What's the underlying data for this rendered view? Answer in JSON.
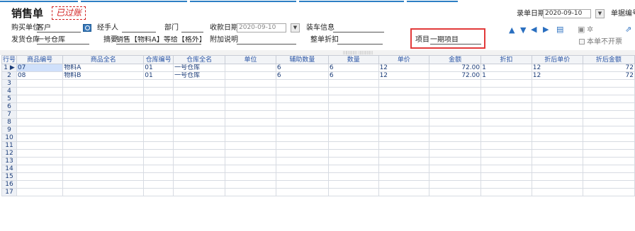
{
  "header": {
    "title": "销售单",
    "stamp": "已过账",
    "record_date_label": "录单日期",
    "record_date_value": "2020-09-10",
    "doc_no_label": "单据编号",
    "not_invoiced_label": "本单不开票"
  },
  "form": {
    "buyer_label": "购买单位",
    "buyer_value": "客户",
    "handler_label": "经手人",
    "handler_value": "",
    "dept_label": "部门",
    "dept_value": "",
    "collect_date_label": "收款日期",
    "collect_date_placeholder": "2020-09-10",
    "loading_label": "装车信息",
    "loading_value": "",
    "warehouse_label": "发货仓库",
    "warehouse_value": "一号仓库",
    "summary_label": "摘要",
    "summary_value": "销售【物料A】等给【格外】:",
    "note_label": "附加说明",
    "note_value": "",
    "discount_label": "整单折扣",
    "discount_value": "",
    "project_label": "项目",
    "project_value": "一期项目"
  },
  "table": {
    "columns": [
      "行号",
      "商品编号",
      "商品全名",
      "仓库编号",
      "仓库全名",
      "单位",
      "辅助数量",
      "数量",
      "单价",
      "金额",
      "折扣",
      "折后单价",
      "折后金额"
    ],
    "rows": [
      {
        "no": "1",
        "code": "07",
        "name": "物料A",
        "wh_code": "01",
        "wh_name": "一号仓库",
        "unit": "",
        "aux_qty": "6",
        "qty": "6",
        "price": "12",
        "amount": "72.00",
        "discount": "1",
        "disc_price": "12",
        "disc_amount": "72"
      },
      {
        "no": "2",
        "code": "08",
        "name": "物料B",
        "wh_code": "01",
        "wh_name": "一号仓库",
        "unit": "",
        "aux_qty": "6",
        "qty": "6",
        "price": "12",
        "amount": "72.00",
        "discount": "1",
        "disc_price": "12",
        "disc_amount": "72"
      }
    ],
    "empty_row_numbers": [
      "3",
      "4",
      "5",
      "6",
      "7",
      "8",
      "9",
      "10",
      "11",
      "12",
      "13",
      "14",
      "15",
      "16",
      "17"
    ],
    "current_row_marker": "▶"
  },
  "icons": {
    "toolbar": [
      "arrow-up-icon",
      "arrow-down-icon",
      "arrow-left-icon",
      "arrow-right-icon",
      "document-icon",
      "print-icon",
      "settings-icon",
      "export-icon"
    ]
  }
}
